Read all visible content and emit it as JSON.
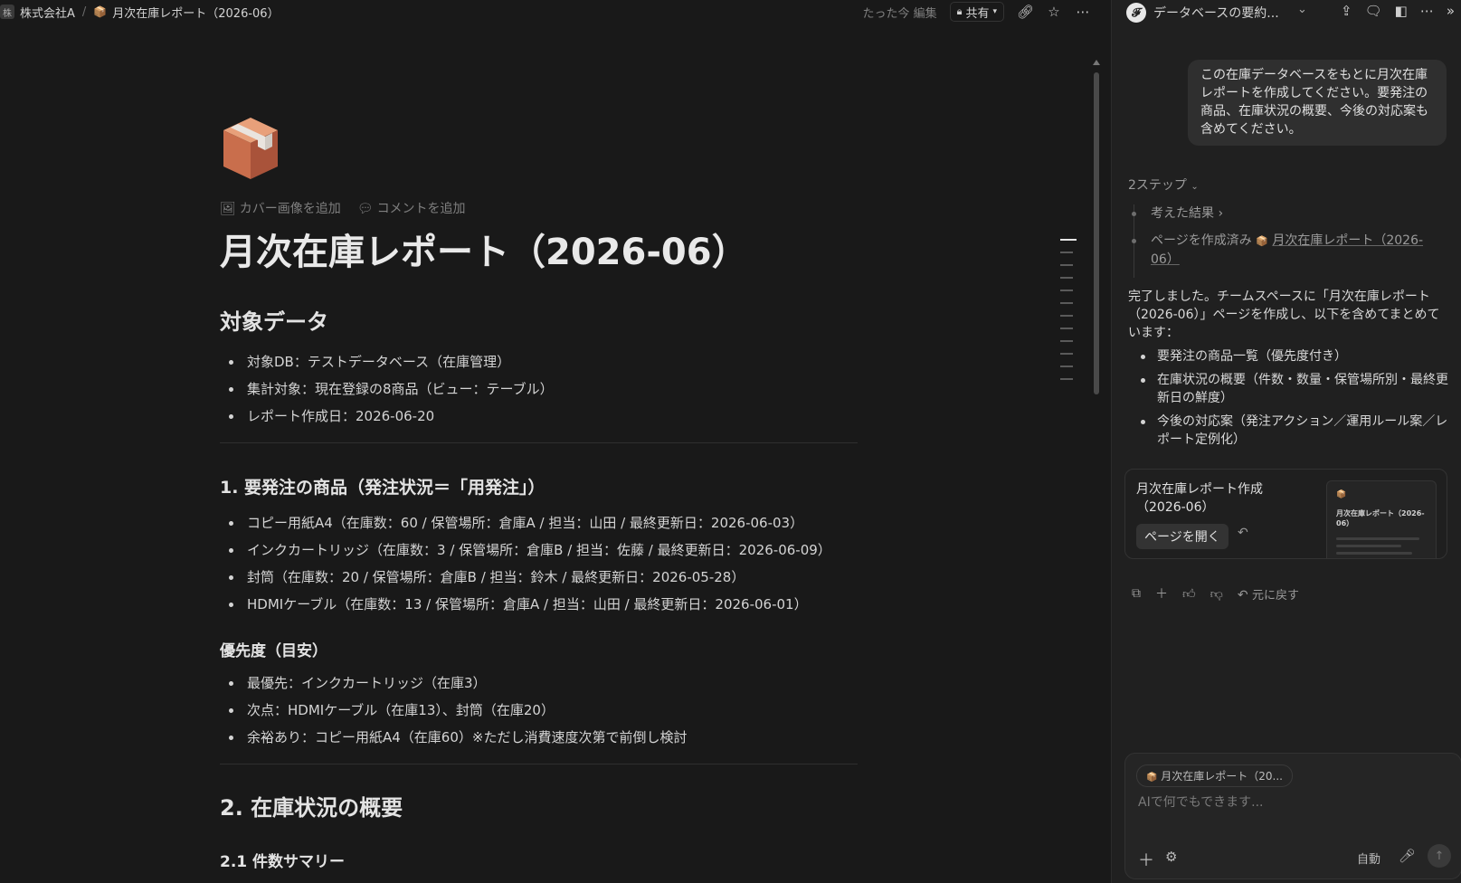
{
  "topbar": {
    "workspace_badge": "株",
    "workspace_name": "株式会社A",
    "separator": "/",
    "page_icon": "📦",
    "page_name": "月次在庫レポート（2026-06）",
    "edited": "たった今 編集",
    "share": "共有"
  },
  "page": {
    "add_cover": "カバー画像を追加",
    "add_comment": "コメントを追加",
    "title": "月次在庫レポート（2026-06）",
    "sections": {
      "target": {
        "heading": "対象データ",
        "items": [
          "対象DB：テストデータベース（在庫管理）",
          "集計対象：現在登録の8商品（ビュー：テーブル）",
          "レポート作成日：2026-06-20"
        ]
      },
      "reorder": {
        "heading": "1. 要発注の商品（発注状況＝「用発注」）",
        "items": [
          "コピー用紙A4（在庫数：60 / 保管場所：倉庫A / 担当：山田 / 最終更新日：2026-06-03）",
          "インクカートリッジ（在庫数：3 / 保管場所：倉庫B / 担当：佐藤 / 最終更新日：2026-06-09）",
          "封筒（在庫数：20 / 保管場所：倉庫B / 担当：鈴木 / 最終更新日：2026-05-28）",
          "HDMIケーブル（在庫数：13 / 保管場所：倉庫A / 担当：山田 / 最終更新日：2026-06-01）"
        ]
      },
      "priority": {
        "heading": "優先度（目安）",
        "items": [
          "最優先：インクカートリッジ（在庫3）",
          "次点：HDMIケーブル（在庫13）、封筒（在庫20）",
          "余裕あり：コピー用紙A4（在庫60）※ただし消費速度次第で前倒し検討"
        ]
      },
      "overview": {
        "heading": "2. 在庫状況の概要",
        "sub_heading": "2.1 件数サマリー"
      }
    }
  },
  "panel": {
    "avatar": "𝓕",
    "title": "データベースの要約...",
    "user_message": "この在庫データベースをもとに月次在庫レポートを作成してください。要発注の商品、在庫状況の概要、今後の対応案も含めてください。",
    "steps_label": "2ステップ",
    "steps": [
      {
        "text": "考えた結果",
        "suffix": "›"
      },
      {
        "text": "ページを作成済み",
        "icon": "📦",
        "link": "月次在庫レポート（2026-06）"
      }
    ],
    "reply_intro": "完了しました。チームスペースに「月次在庫レポート（2026-06）」ページを作成し、以下を含めてまとめています：",
    "reply_items": [
      "要発注の商品一覧（優先度付き）",
      "在庫状況の概要（件数・数量・保管場所別・最終更新日の鮮度）",
      "今後の対応案（発注アクション／運用ルール案／レポート定例化）"
    ],
    "card": {
      "title": "月次在庫レポート作成（2026-06）",
      "open_button": "ページを開く",
      "thumb_icon": "📦",
      "thumb_title": "月次在庫レポート（2026-06）"
    },
    "undo_label": "元に戻す",
    "composer": {
      "context_chip": "月次在庫レポート（20...",
      "chip_icon": "📦",
      "placeholder": "AIで何でもできます...",
      "mode": "自動"
    }
  },
  "colors": {
    "background": "#191919",
    "panel": "#202020",
    "text": "#d4d4d4"
  }
}
